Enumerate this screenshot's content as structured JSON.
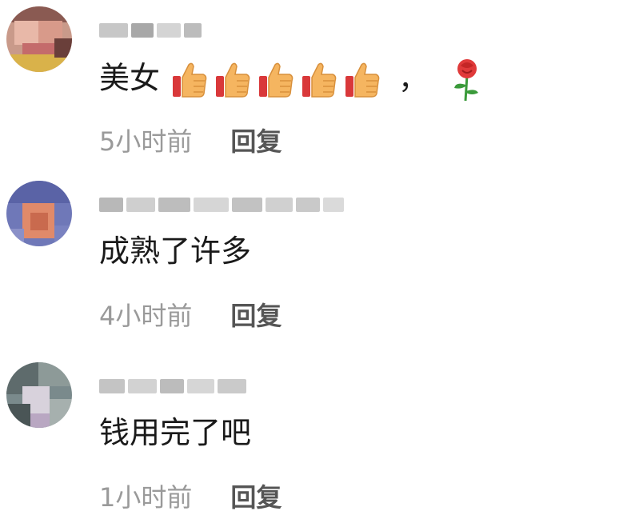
{
  "comments": [
    {
      "username": "",
      "text": "美女",
      "emojis": [
        "thumbs-up",
        "thumbs-up",
        "thumbs-up",
        "thumbs-up",
        "thumbs-up",
        "rose"
      ],
      "time": "5小时前",
      "reply_label": "回复"
    },
    {
      "username": "",
      "text": "成熟了许多",
      "emojis": [],
      "time": "4小时前",
      "reply_label": "回复"
    },
    {
      "username": "",
      "text": "钱用完了吧",
      "emojis": [],
      "time": "1小时前",
      "reply_label": "回复"
    }
  ],
  "colors": {
    "text": "#1a1a1a",
    "time": "#9a9a9a",
    "reply": "#555555"
  }
}
